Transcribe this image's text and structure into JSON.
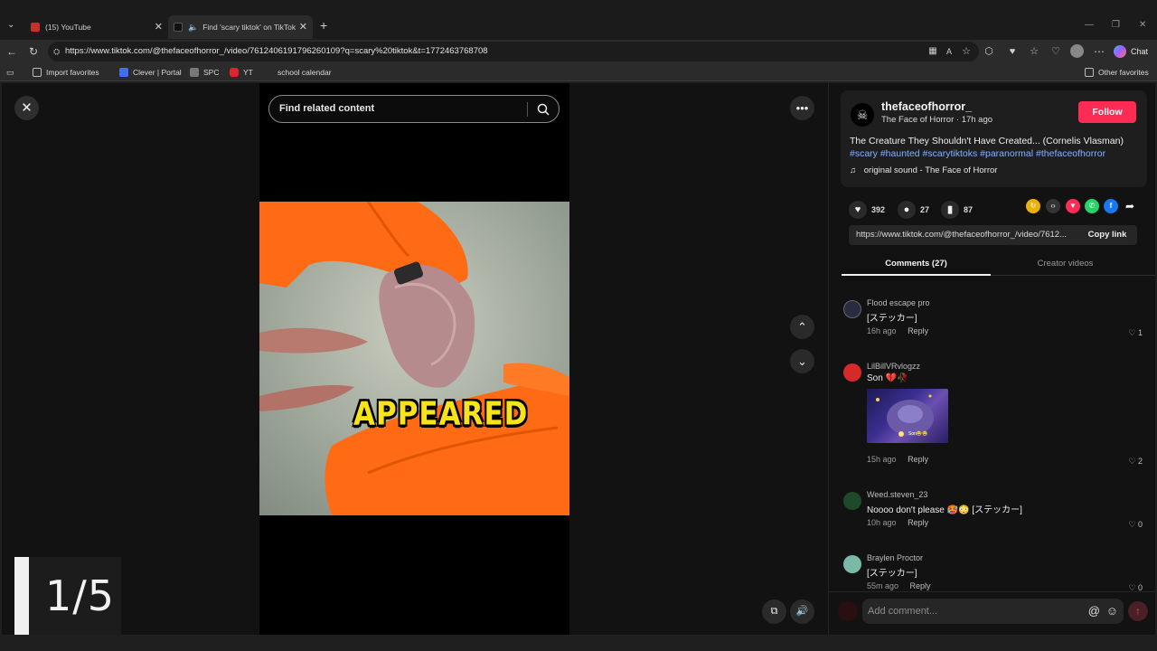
{
  "browser": {
    "tabs": [
      {
        "label": "(15) YouTube",
        "active": false
      },
      {
        "label": "Find 'scary tiktok' on TikTok |",
        "active": true
      }
    ],
    "new_tab": "+",
    "url": "https://www.tiktok.com/@thefaceofhorror_/video/7612406191796260109?q=scary%20tiktok&t=1772463768708",
    "chat_label": "Chat",
    "favorites": [
      {
        "label": "Import favorites"
      },
      {
        "label": "Clever | Portal"
      },
      {
        "label": "SPC"
      },
      {
        "label": "YT"
      },
      {
        "label": "school calendar"
      }
    ],
    "other_favorites": "Other favorites"
  },
  "video": {
    "search_placeholder": "Find related content",
    "caption": "APPEARED",
    "counter": "1/5"
  },
  "post": {
    "username": "thefaceofhorror_",
    "byline": "The Face of Horror · 17h ago",
    "follow_label": "Follow",
    "title": "The Creature They Shouldn't Have Created... (Cornelis Vlasman)",
    "hashtags": "#scary #haunted #scarytiktoks #paranormal #thefaceofhorror",
    "sound": "original sound - The Face of Horror",
    "likes": "392",
    "comments": "27",
    "saves": "87",
    "link": "https://www.tiktok.com/@thefaceofhorror_/video/7612...",
    "copy_link": "Copy link",
    "tab_comments": "Comments (27)",
    "tab_creator": "Creator videos"
  },
  "comments": [
    {
      "user": "Flood escape pro",
      "text": "[ステッカー]",
      "age": "16h ago",
      "reply": "Reply",
      "likes": "1"
    },
    {
      "user": "LilBillVRvlogzz",
      "text": "Son 💔🥀",
      "age": "15h ago",
      "reply": "Reply",
      "likes": "2",
      "image_text": "Son😂😂"
    },
    {
      "user": "Weed.steven_23",
      "text": "Noooo don't please 🥵😳 [ステッカー]",
      "age": "10h ago",
      "reply": "Reply",
      "likes": "0"
    },
    {
      "user": "Braylen Proctor",
      "text": "[ステッカー]",
      "age": "55m ago",
      "reply": "Reply",
      "likes": "0"
    }
  ],
  "composer": {
    "placeholder": "Add comment..."
  },
  "colors": {
    "accent": "#fe2c55",
    "hashtag": "#80b4ff",
    "caption": "#f7e31c"
  }
}
